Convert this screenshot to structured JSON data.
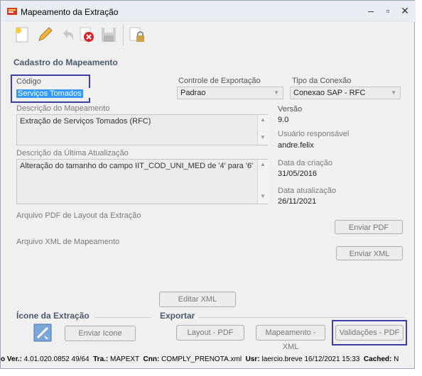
{
  "window": {
    "title": "Mapeamento da Extração"
  },
  "toolbar": {
    "icons": [
      "new-icon",
      "edit-icon",
      "undo-icon",
      "delete-icon",
      "save-icon",
      "lock-icon"
    ]
  },
  "form": {
    "section_title": "Cadastro do Mapeamento",
    "codigo_label": "Código",
    "codigo_value": "Serviços Tomados",
    "controle_label": "Controle de Exportação",
    "controle_value": "Padrao",
    "tipo_label": "Tipo da Conexão",
    "tipo_value": "Conexao SAP - RFC",
    "descricao_label": "Descrição do Mapeamento",
    "descricao_value": "Extração de Serviços Tomados (RFC)",
    "versao_label": "Versão",
    "versao_value": "9.0",
    "usuario_label": "Usuário responsável",
    "usuario_value": "andre.felix",
    "ultima_label": "Descrição da Última Atualização",
    "ultima_value": "Alteração do tamanho do campo IIT_COD_UNI_MED de '4' para '6'",
    "data_criacao_label": "Data da criação",
    "data_criacao_value": "31/05/2016",
    "data_atualizacao_label": "Data atualização",
    "data_atualizacao_value": "26/11/2021",
    "pdf_label": "Arquivo PDF de Layout da Extração",
    "enviar_pdf": "Enviar PDF",
    "xml_label": "Arquivo XML de Mapeamento",
    "enviar_xml": "Enviar XML",
    "editar_xml": "Editar XML"
  },
  "icone": {
    "title": "Ícone da Extração",
    "enviar_icone": "Enviar Icone"
  },
  "exportar": {
    "title": "Exportar",
    "layout_pdf": "Layout - PDF",
    "mapeamento_xml": "Mapeamento - XML",
    "validacoes_pdf": "Validações - PDF"
  },
  "statusbar": {
    "ver_label": "o Ver.:",
    "ver_value": "4.01.020.0852",
    "ver_extra": "49/64",
    "tra_label": "Tra.:",
    "tra_value": "MAPEXT",
    "cnn_label": "Cnn:",
    "cnn_value": "COMPLY_PRENOTA.xml",
    "usr_label": "Usr:",
    "usr_value": "laercio.breve",
    "datetime": "16/12/2021 15:33",
    "cached_label": "Cached:",
    "cached_value": "N"
  }
}
